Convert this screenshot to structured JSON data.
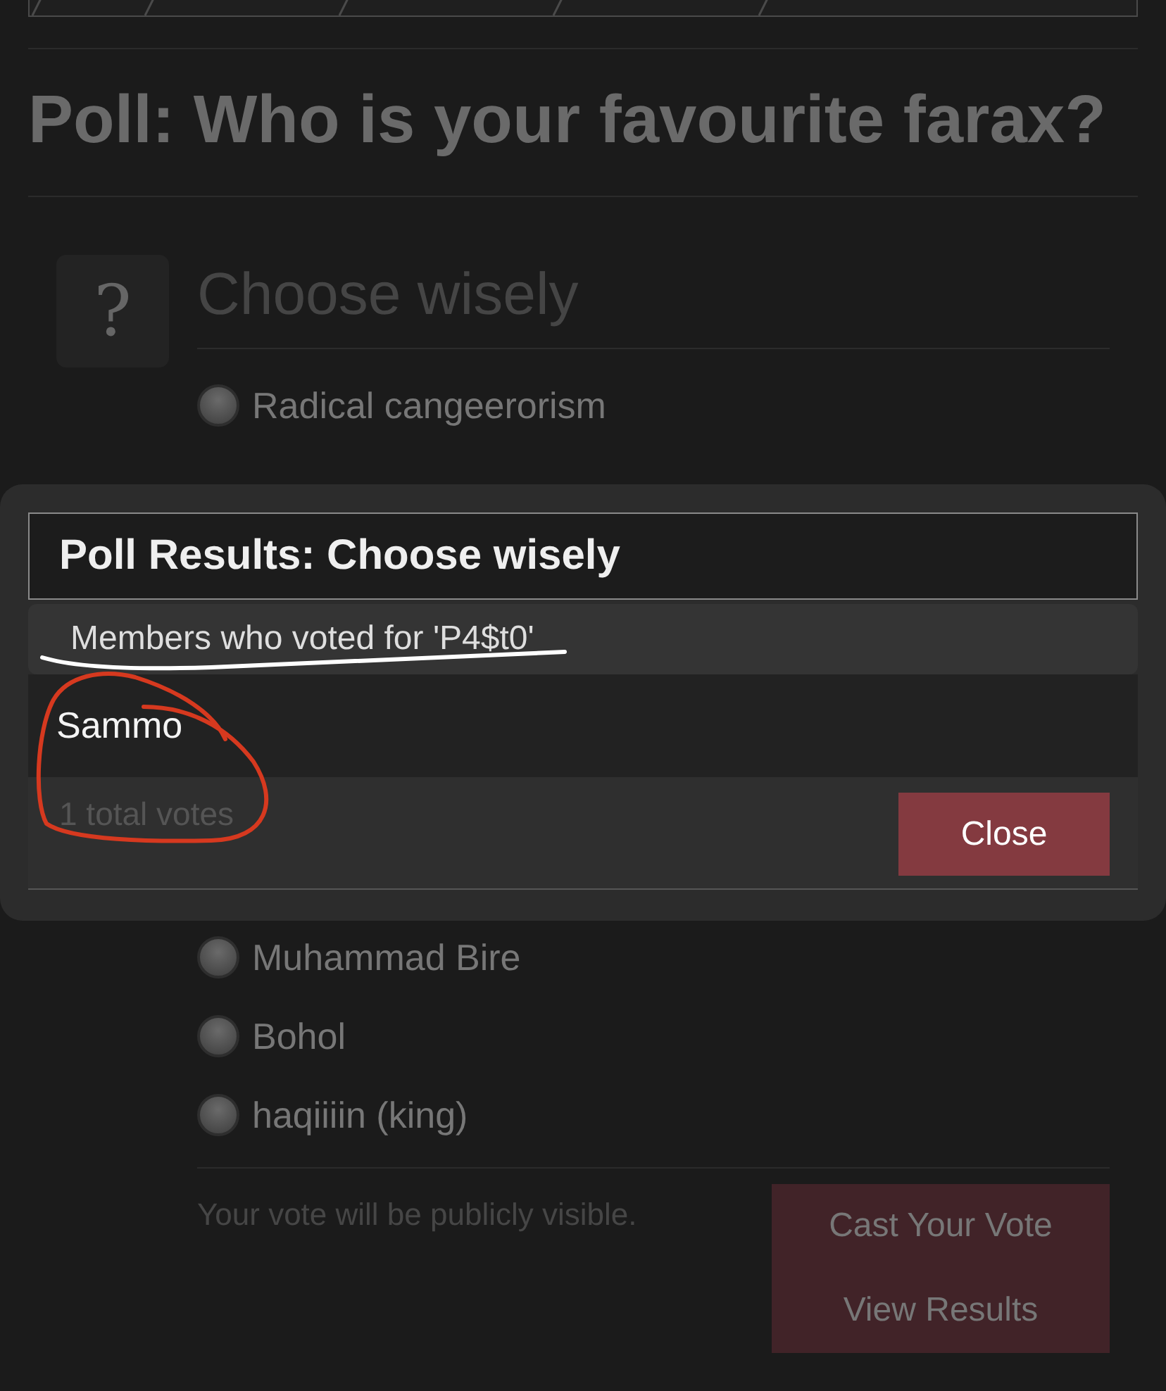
{
  "poll_title": "Poll: Who is your favourite farax?",
  "poll": {
    "icon": "?",
    "question": "Choose wisely",
    "options_top": [
      {
        "label": "Radical cangeerorism",
        "selected": false
      }
    ],
    "options_bottom": [
      {
        "label": "Muhammad Bire",
        "selected": false
      },
      {
        "label": "Bohol",
        "selected": false
      },
      {
        "label": "haqiiiin (king)",
        "selected": false
      }
    ],
    "note": "Your vote will be publicly visible.",
    "buttons": [
      "Cast Your Vote",
      "View Results"
    ]
  },
  "results_dialog": {
    "title": "Poll Results: Choose wisely",
    "tab": "Members who voted for 'P4$t0'",
    "voters": [
      "Sammo"
    ],
    "total": "1 total votes",
    "close_button": "Close"
  }
}
